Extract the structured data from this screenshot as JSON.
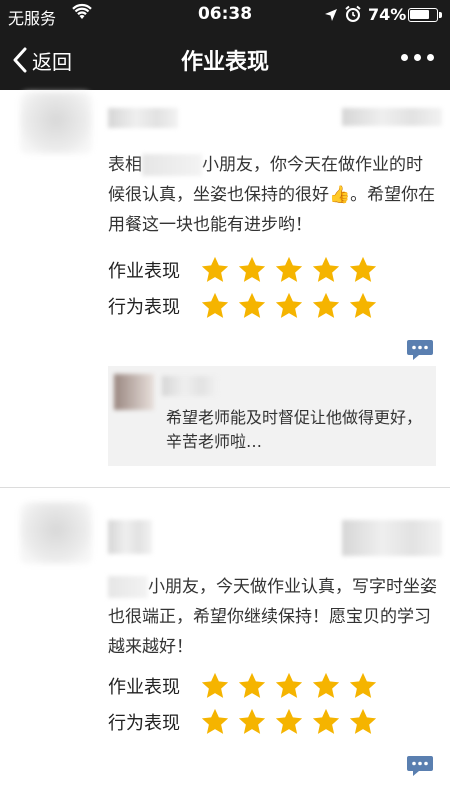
{
  "status_bar": {
    "carrier": "无服务",
    "time": "06:38",
    "battery": "74%",
    "battery_level": 0.74,
    "icons": [
      "wifi-icon",
      "location-arrow-icon",
      "alarm-icon",
      "battery-icon"
    ]
  },
  "nav": {
    "back_label": "返回",
    "title": "作业表现",
    "more_icon": "ellipsis-icon"
  },
  "colors": {
    "nav_bg": "#1b1b1b",
    "star": "#f5b400",
    "comment_icon": "#5a7fb0",
    "reply_bg": "#f2f2f2"
  },
  "entries": [
    {
      "comment_start": "表相",
      "comment_rest": "小朋友，你今天在做作业的时候很认真，坐姿也保持的很好👍。希望你在用餐这一块也能有进步哟！",
      "ratings": [
        {
          "label": "作业表现",
          "stars": 5,
          "max": 5
        },
        {
          "label": "行为表现",
          "stars": 5,
          "max": 5
        }
      ],
      "reply": "希望老师能及时督促让他做得更好，辛苦老师啦…"
    },
    {
      "comment_start": "",
      "comment_rest": "小朋友，今天做作业认真，写字时坐姿也很端正，希望你继续保持！愿宝贝的学习越来越好！",
      "ratings": [
        {
          "label": "作业表现",
          "stars": 5,
          "max": 5
        },
        {
          "label": "行为表现",
          "stars": 5,
          "max": 5
        }
      ]
    }
  ]
}
